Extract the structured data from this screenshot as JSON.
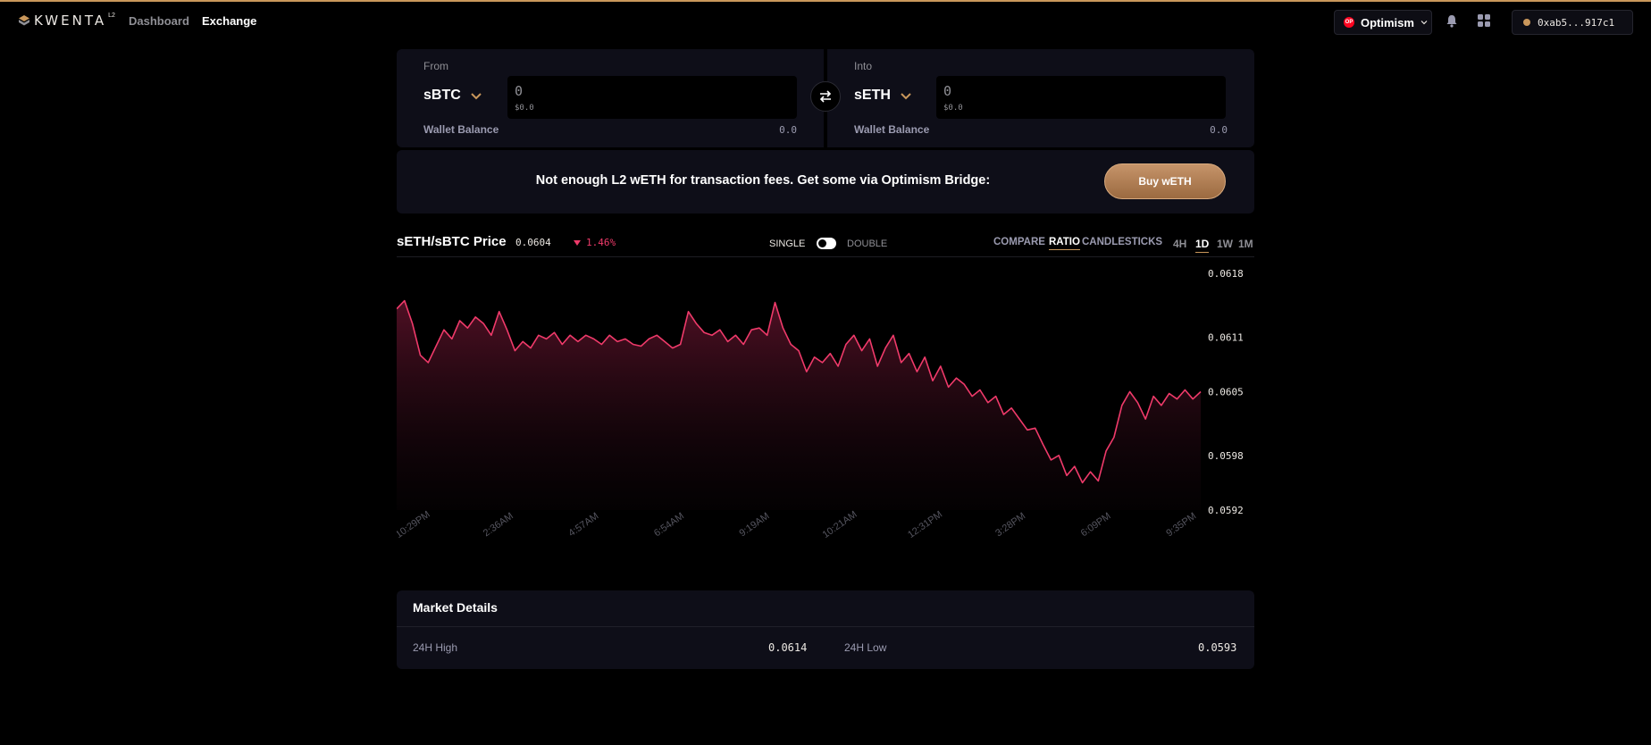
{
  "nav": {
    "logo_text": "KWENTA",
    "logo_sup": "L2",
    "links": [
      "Dashboard",
      "Exchange"
    ],
    "network": "Optimism",
    "wallet": "0xab5...917c1"
  },
  "swap": {
    "from": {
      "label": "From",
      "currency": "sBTC",
      "amount_placeholder": "0",
      "usd_value": "$0.0",
      "balance_label": "Wallet Balance",
      "balance_value": "0.0"
    },
    "into": {
      "label": "Into",
      "currency": "sETH",
      "amount_placeholder": "0",
      "usd_value": "$0.0",
      "balance_label": "Wallet Balance",
      "balance_value": "0.0"
    }
  },
  "banner": {
    "message": "Not enough L2 wETH for transaction fees. Get some via Optimism Bridge:",
    "button_label": "Buy wETH"
  },
  "chart_header": {
    "pair": "sETH/sBTC Price",
    "price": "0.0604",
    "change": "1.46%",
    "mode_single": "SINGLE",
    "mode_double": "DOUBLE",
    "chart_types": [
      "COMPARE",
      "RATIO",
      "CANDLESTICKS"
    ],
    "active_chart_type": "RATIO",
    "timeframes": [
      "4H",
      "1D",
      "1W",
      "1M"
    ],
    "active_timeframe": "1D"
  },
  "colors": {
    "accent": "#c9975b",
    "line": "#ef3a6a",
    "negative": "#ef3a6a",
    "panel": "#0e0e18"
  },
  "chart_data": {
    "type": "area",
    "ylim": [
      0.0592,
      0.0618
    ],
    "y_ticks": [
      "0.0618",
      "0.0611",
      "0.0605",
      "0.0598",
      "0.0592"
    ],
    "x_ticks": [
      "10:29PM",
      "2:36AM",
      "4:57AM",
      "6:54AM",
      "9:19AM",
      "10:21AM",
      "12:31PM",
      "3:28PM",
      "6:09PM",
      "9:35PM"
    ],
    "series": [
      {
        "values": [
          0.06141,
          0.0615,
          0.06125,
          0.0609,
          0.06082,
          0.061,
          0.06118,
          0.06108,
          0.06128,
          0.0612,
          0.06132,
          0.06125,
          0.06112,
          0.06138,
          0.06118,
          0.06095,
          0.06105,
          0.06098,
          0.06112,
          0.06108,
          0.06115,
          0.06102,
          0.06112,
          0.06105,
          0.06112,
          0.06108,
          0.06102,
          0.06112,
          0.06105,
          0.06108,
          0.06102,
          0.061,
          0.06108,
          0.06112,
          0.06105,
          0.06098,
          0.06102,
          0.06138,
          0.06125,
          0.06115,
          0.06112,
          0.06118,
          0.06105,
          0.06112,
          0.06102,
          0.06118,
          0.0612,
          0.06112,
          0.06148,
          0.0612,
          0.06102,
          0.06095,
          0.06072,
          0.06088,
          0.06082,
          0.06092,
          0.06078,
          0.06102,
          0.06112,
          0.06095,
          0.06108,
          0.06078,
          0.06098,
          0.06112,
          0.06082,
          0.06092,
          0.06072,
          0.06088,
          0.06062,
          0.06078,
          0.06055,
          0.06065,
          0.06058,
          0.06045,
          0.06052,
          0.06038,
          0.06045,
          0.06025,
          0.06032,
          0.0602,
          0.06008,
          0.0601,
          0.05992,
          0.05975,
          0.0598,
          0.05958,
          0.05968,
          0.0595,
          0.05962,
          0.05952,
          0.05985,
          0.06,
          0.06035,
          0.0605,
          0.06038,
          0.0602,
          0.06045,
          0.06035,
          0.06048,
          0.06042,
          0.06052,
          0.06042,
          0.0605
        ]
      }
    ]
  },
  "market_details": {
    "title": "Market Details",
    "high_label": "24H High",
    "high_value": "0.0614",
    "low_label": "24H Low",
    "low_value": "0.0593"
  }
}
